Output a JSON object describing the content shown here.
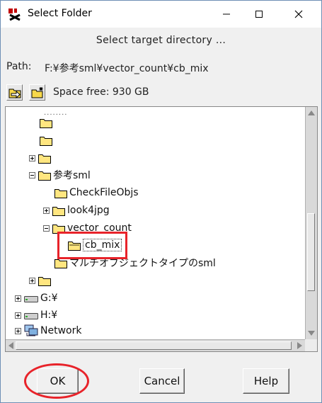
{
  "window": {
    "title": "Select Folder"
  },
  "titlebar_buttons": {
    "minimize": "minimize-icon",
    "maximize": "maximize-icon",
    "close": "close-icon"
  },
  "header": {
    "text": "Select target directory ..."
  },
  "path": {
    "label": "Path:",
    "value": "F:¥参考sml¥vector_count¥cb_mix"
  },
  "toolbar": {
    "space_free": "Space free: 930 GB"
  },
  "tree": {
    "items": [
      {
        "label": ""
      },
      {
        "label": ""
      },
      {
        "label": ""
      },
      {
        "label": "参考sml"
      },
      {
        "label": "CheckFileObjs"
      },
      {
        "label": "look4jpg"
      },
      {
        "label": "vector_count"
      },
      {
        "label": "cb_mix"
      },
      {
        "label": "マルチオブジェクトタイプのsml"
      },
      {
        "label": ""
      },
      {
        "label": "G:¥"
      },
      {
        "label": "H:¥"
      },
      {
        "label": "Network"
      }
    ]
  },
  "buttons": {
    "ok": "OK",
    "cancel": "Cancel",
    "help": "Help"
  },
  "colors": {
    "annotation": "#e8232a",
    "folder": "#ffe680",
    "selection_border": "#333333"
  }
}
